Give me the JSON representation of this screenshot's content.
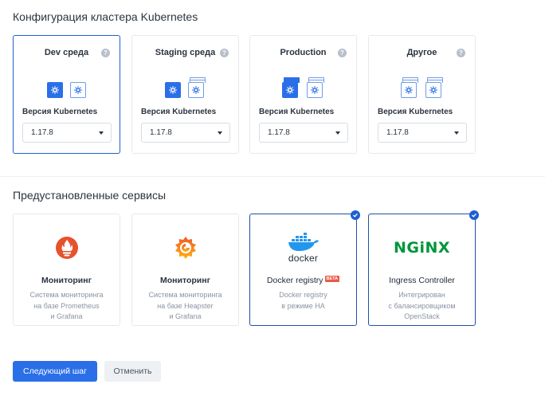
{
  "cluster_config": {
    "title": "Конфигурация кластера Kubernetes",
    "help_glyph": "?",
    "cards": [
      {
        "label": "Dev среда",
        "version_label": "Версия Kubernetes",
        "version": "1.17.8",
        "selected": true
      },
      {
        "label": "Staging среда",
        "version_label": "Версия Kubernetes",
        "version": "1.17.8",
        "selected": false
      },
      {
        "label": "Production",
        "version_label": "Версия Kubernetes",
        "version": "1.17.8",
        "selected": false
      },
      {
        "label": "Другое",
        "version_label": "Версия Kubernetes",
        "version": "1.17.8",
        "selected": false
      }
    ]
  },
  "services": {
    "title": "Предустановленные сервисы",
    "cards": [
      {
        "name": "Мониторинг",
        "desc": [
          "Система мониторинга",
          "на базе Prometheus",
          "и Grafana"
        ],
        "logo": "prometheus-logo",
        "selected": false
      },
      {
        "name": "Мониторинг",
        "desc": [
          "Система мониторинга",
          "на базе Heapster",
          "и Grafana"
        ],
        "logo": "grafana-logo",
        "selected": false
      },
      {
        "name": "Docker registry",
        "badge": "BETA",
        "logo_text": "docker",
        "desc": [
          "Docker registry",
          "в режиме HA"
        ],
        "logo": "docker-logo",
        "selected": true
      },
      {
        "name": "Ingress Controller",
        "logo_text": "NGiNX",
        "desc": [
          "Интегрирован",
          "с балансировщиком",
          "OpenStack"
        ],
        "logo": "nginx-logo",
        "selected": true
      }
    ]
  },
  "actions": {
    "next": "Следующий шаг",
    "cancel": "Отменить"
  },
  "colors": {
    "accent": "#2a6fe8",
    "selected_border": "#1f5fd1",
    "prometheus": "#e6522c",
    "grafana": "#f46800",
    "docker": "#2496ed",
    "nginx": "#009639"
  }
}
